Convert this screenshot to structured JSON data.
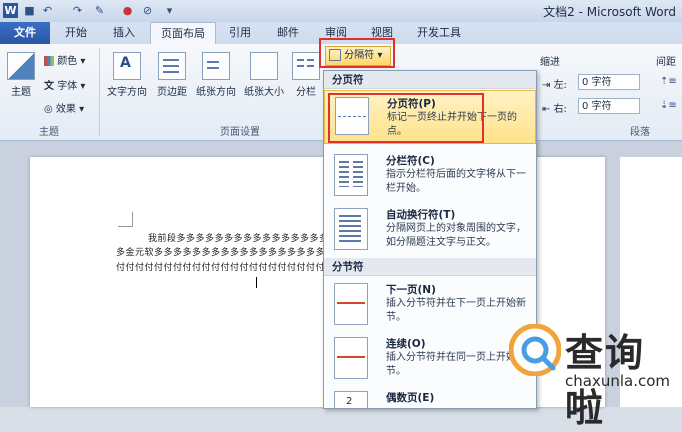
{
  "window": {
    "title": "文档2 - Microsoft Word"
  },
  "quick_access": [
    "save-icon",
    "undo-icon",
    "redo-icon",
    "format-painter-icon",
    "color-icon",
    "clear-icon",
    "customize-icon"
  ],
  "tabs": [
    {
      "label": "文件",
      "kind": "file"
    },
    {
      "label": "开始"
    },
    {
      "label": "插入"
    },
    {
      "label": "页面布局",
      "active": true
    },
    {
      "label": "引用"
    },
    {
      "label": "邮件"
    },
    {
      "label": "审阅"
    },
    {
      "label": "视图"
    },
    {
      "label": "开发工具"
    }
  ],
  "ribbon": {
    "theme_group": {
      "label": "主题",
      "theme_btn": "主题",
      "colors": "颜色",
      "fonts": "字体",
      "effects": "效果"
    },
    "page_setup_group": {
      "label": "页面设置",
      "text_direction": "文字方向",
      "margins": "页边距",
      "orientation": "纸张方向",
      "size": "纸张大小",
      "columns": "分栏",
      "breaks": "分隔符"
    },
    "paragraph_group": {
      "label": "段落",
      "indent_title": "缩进",
      "spacing_title": "间距",
      "left_label": "左:",
      "left_value": "0 字符",
      "right_label": "右:",
      "right_value": "0 字符"
    }
  },
  "document": {
    "line1": "我前段多多多多多多多多多多多多多多多多多多多",
    "line2": "多金元软多多多多多多多多多多多多多多多多多多多多",
    "line3": "付付付付付付付付付付付付付付付付付付付付付付付付付付"
  },
  "breaks_menu": {
    "section1": "分页符",
    "items1": [
      {
        "title": "分页符(P)",
        "desc": "标记一页终止并开始下一页的点。",
        "highlighted": true
      },
      {
        "title": "分栏符(C)",
        "desc": "指示分栏符后面的文字将从下一栏开始。"
      },
      {
        "title": "自动换行符(T)",
        "desc": "分隔网页上的对象周围的文字，如分隔题注文字与正文。"
      }
    ],
    "section2": "分节符",
    "items2": [
      {
        "title": "下一页(N)",
        "desc": "插入分节符并在下一页上开始新节。"
      },
      {
        "title": "连续(O)",
        "desc": "插入分节符并在同一页上开始新节。"
      },
      {
        "title": "偶数页(E)",
        "desc": ""
      }
    ]
  },
  "watermark": {
    "brand": "查询啦",
    "url": "chaxunla.com"
  },
  "colors": {
    "accent": "#2a56a4",
    "highlight": "#ffe28a",
    "red_box": "#e0312a"
  }
}
